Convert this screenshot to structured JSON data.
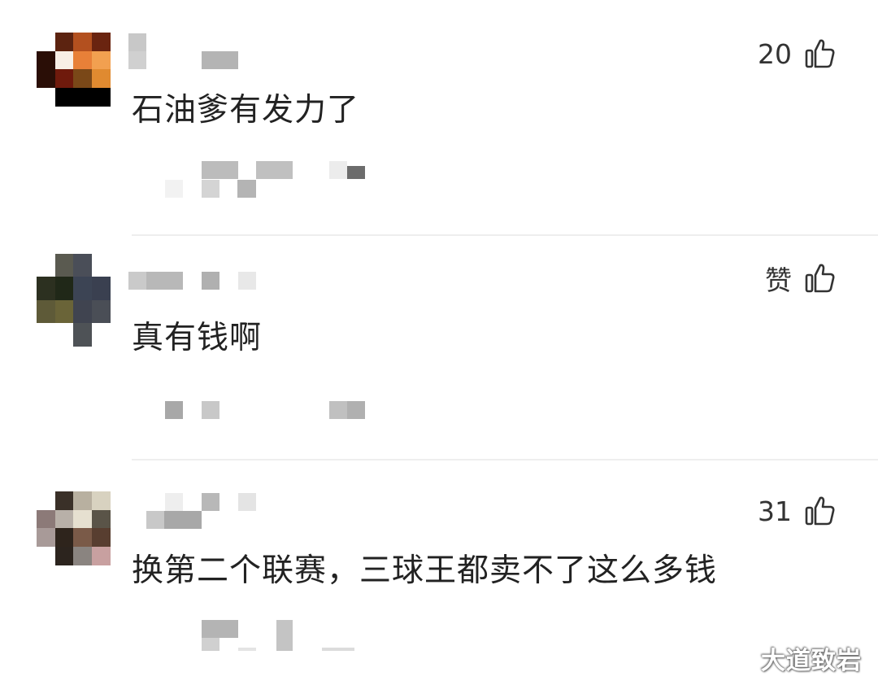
{
  "comments": [
    {
      "text": "石油爹有发力了",
      "likes": "20",
      "avatar_colors": [
        [
          "#ffffff",
          "#5c2310",
          "#b3501f",
          "#6a2410"
        ],
        [
          "#2a0e06",
          "#f8efe6",
          "#e88038",
          "#f2a050"
        ],
        [
          "#2a0e06",
          "#6f1a0c",
          "#7a4818",
          "#e08a30"
        ],
        [
          "#ffffff",
          "#000000",
          "#000000",
          "#000000"
        ]
      ]
    },
    {
      "text": "真有钱啊",
      "likes": "赞",
      "avatar_colors": [
        [
          "#ffffff",
          "#5a5a50",
          "#4a4e58",
          "#ffffff"
        ],
        [
          "#2c3020",
          "#202818",
          "#3c4454",
          "#3a4050"
        ],
        [
          "#5e5a38",
          "#6a6438",
          "#404450",
          "#4a4e56"
        ],
        [
          "#ffffff",
          "#ffffff",
          "#4e5256",
          "#ffffff"
        ]
      ]
    },
    {
      "text": "换第二个联赛，三球王都卖不了这么多钱",
      "likes": "31",
      "avatar_colors": [
        [
          "#ffffff",
          "#3a3028",
          "#b8b0a0",
          "#d8d2c0"
        ],
        [
          "#8c7a78",
          "#b8b0a8",
          "#e6e0d0",
          "#5a5448"
        ],
        [
          "#a89a98",
          "#2e241c",
          "#7a5a48",
          "#583e30"
        ],
        [
          "#ffffff",
          "#2c241e",
          "#8a8480",
          "#c8a0a0"
        ]
      ]
    }
  ],
  "like_icon": "thumbs-up-icon",
  "watermark": "大道致岩"
}
